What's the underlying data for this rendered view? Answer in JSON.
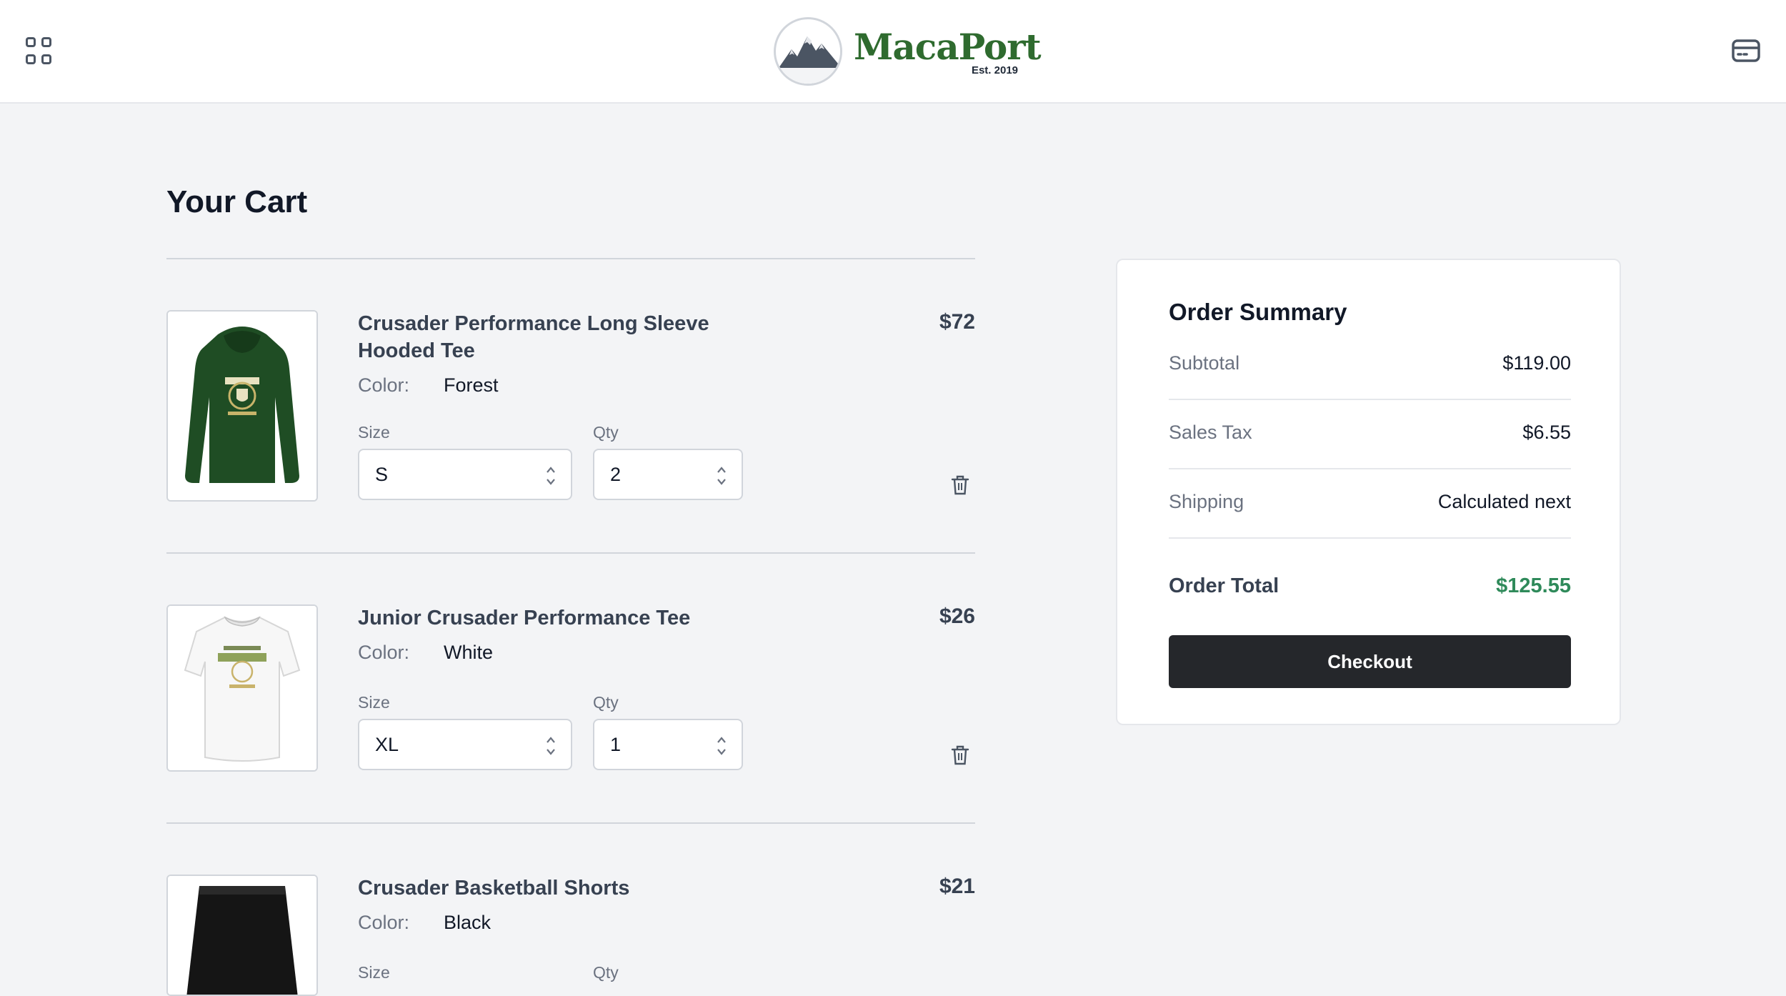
{
  "header": {
    "logo_name": "MacaPort",
    "logo_est": "Est. 2019"
  },
  "page_title": "Your Cart",
  "cart": {
    "color_label": "Color:",
    "size_label": "Size",
    "qty_label": "Qty",
    "items": [
      {
        "title": "Crusader Performance Long Sleeve Hooded Tee",
        "price": "$72",
        "color": "Forest",
        "size": "S",
        "qty": "2"
      },
      {
        "title": "Junior Crusader Performance Tee",
        "price": "$26",
        "color": "White",
        "size": "XL",
        "qty": "1"
      },
      {
        "title": "Crusader Basketball Shorts",
        "price": "$21",
        "color": "Black"
      }
    ]
  },
  "summary": {
    "title": "Order Summary",
    "subtotal_label": "Subtotal",
    "subtotal_value": "$119.00",
    "tax_label": "Sales Tax",
    "tax_value": "$6.55",
    "shipping_label": "Shipping",
    "shipping_value": "Calculated next",
    "total_label": "Order Total",
    "total_value": "$125.55",
    "checkout_label": "Checkout"
  },
  "colors": {
    "brand_green": "#2f6b2f",
    "total_green": "#2f8a5a",
    "checkout_bg": "#25272b"
  }
}
